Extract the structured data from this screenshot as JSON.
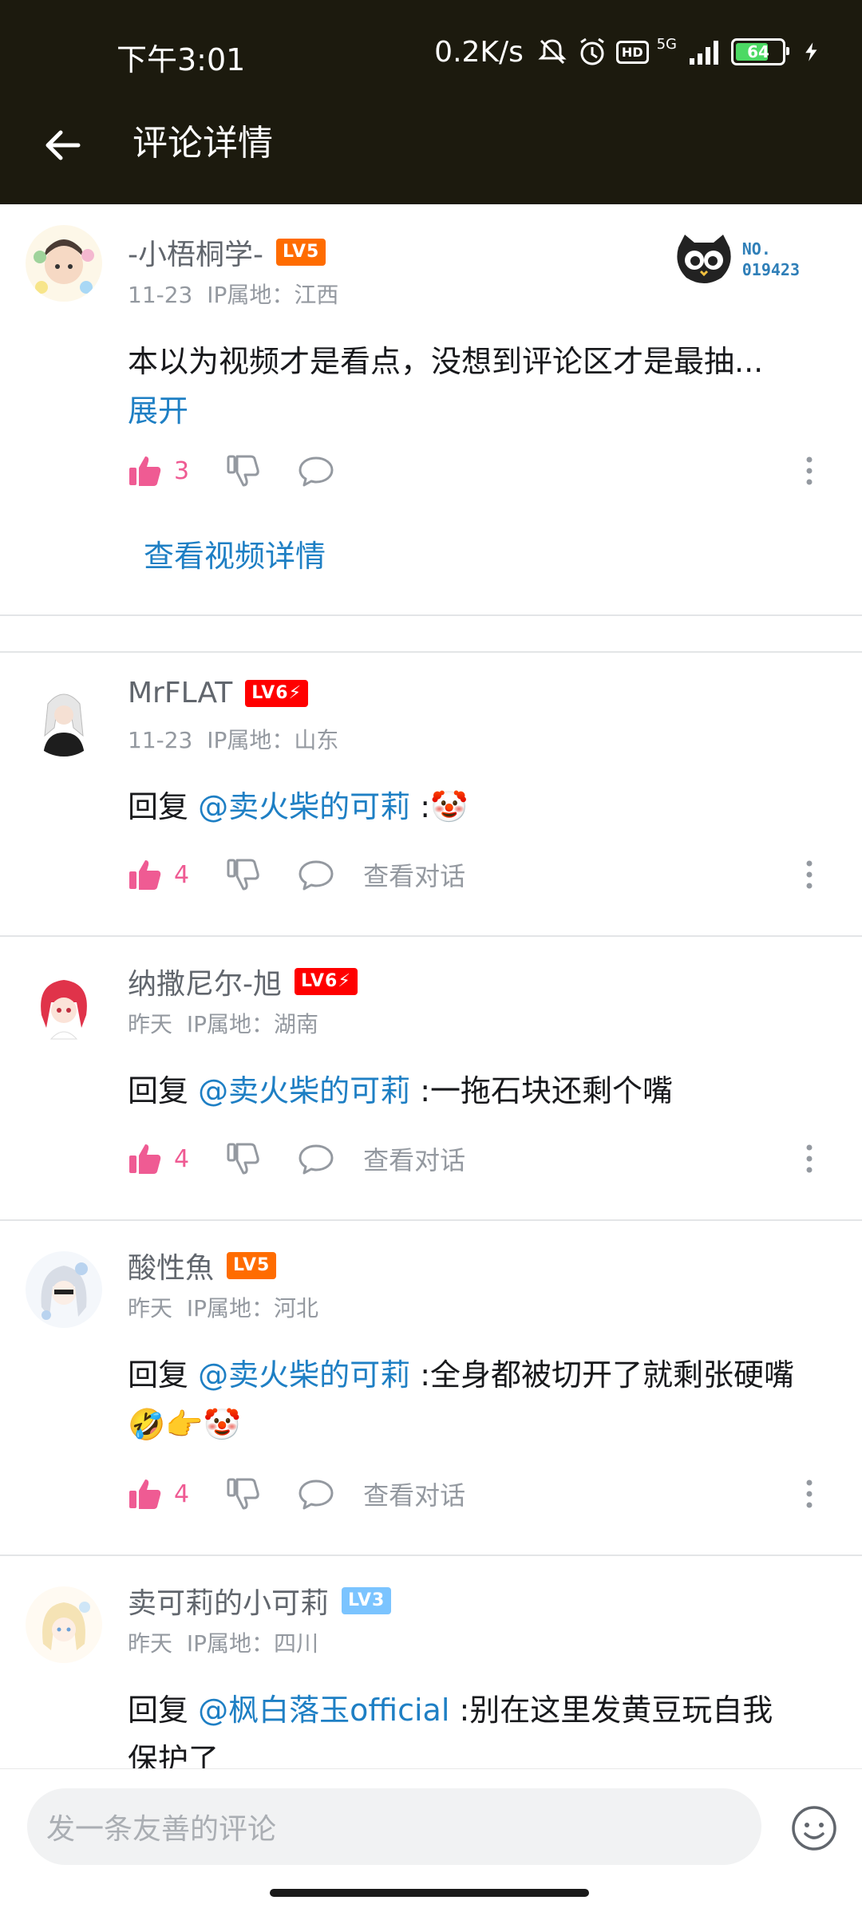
{
  "status_bar": {
    "time": "下午3:01",
    "net_speed": "0.2K/s",
    "hd": "HD",
    "network": "5G",
    "battery": "64"
  },
  "header": {
    "title": "评论详情"
  },
  "root_comment": {
    "username": "-小梧桐学-",
    "level": "LV5",
    "date": "11-23",
    "ip": "IP属地：江西",
    "text": "本以为视频才是看点，没想到评论区才是最抽...",
    "expand": "展开",
    "likes": "3",
    "badge_no_label": "NO.",
    "badge_no_value": "019423",
    "view_video": "查看视频详情"
  },
  "replies": [
    {
      "username": "MrFLAT",
      "level": "LV6⚡",
      "date": "11-23",
      "ip": "IP属地：山东",
      "reply_prefix": "回复",
      "mention": "@卖火柴的可莉",
      "text": ":🤡",
      "likes": "4",
      "view_conv": "查看对话"
    },
    {
      "username": "纳撒尼尔-旭",
      "level": "LV6⚡",
      "date": "昨天",
      "ip": "IP属地：湖南",
      "reply_prefix": "回复",
      "mention": "@卖火柴的可莉",
      "text": ":一拖石块还剩个嘴",
      "likes": "4",
      "view_conv": "查看对话"
    },
    {
      "username": "酸性魚",
      "level": "LV5",
      "date": "昨天",
      "ip": "IP属地：河北",
      "reply_prefix": "回复",
      "mention": "@卖火柴的可莉",
      "text": ":全身都被切开了就剩张硬嘴",
      "text2": "🤣👉🤡",
      "likes": "4",
      "view_conv": "查看对话"
    },
    {
      "username": "卖可莉的小可莉",
      "level": "LV3",
      "date": "昨天",
      "ip": "IP属地：四川",
      "reply_prefix": "回复",
      "mention": "@枫白落玉official",
      "text": ":别在这里发黄豆玩自我",
      "text2": "保护了"
    }
  ],
  "input": {
    "placeholder": "发一条友善的评论"
  },
  "colors": {
    "header_bg": "#1c1a0e",
    "accent_link": "#1e7fc4",
    "like_pink": "#ef5b93",
    "lv5": "#ff6c00",
    "lv6": "#ff0000",
    "lv3": "#7bc4ff"
  }
}
